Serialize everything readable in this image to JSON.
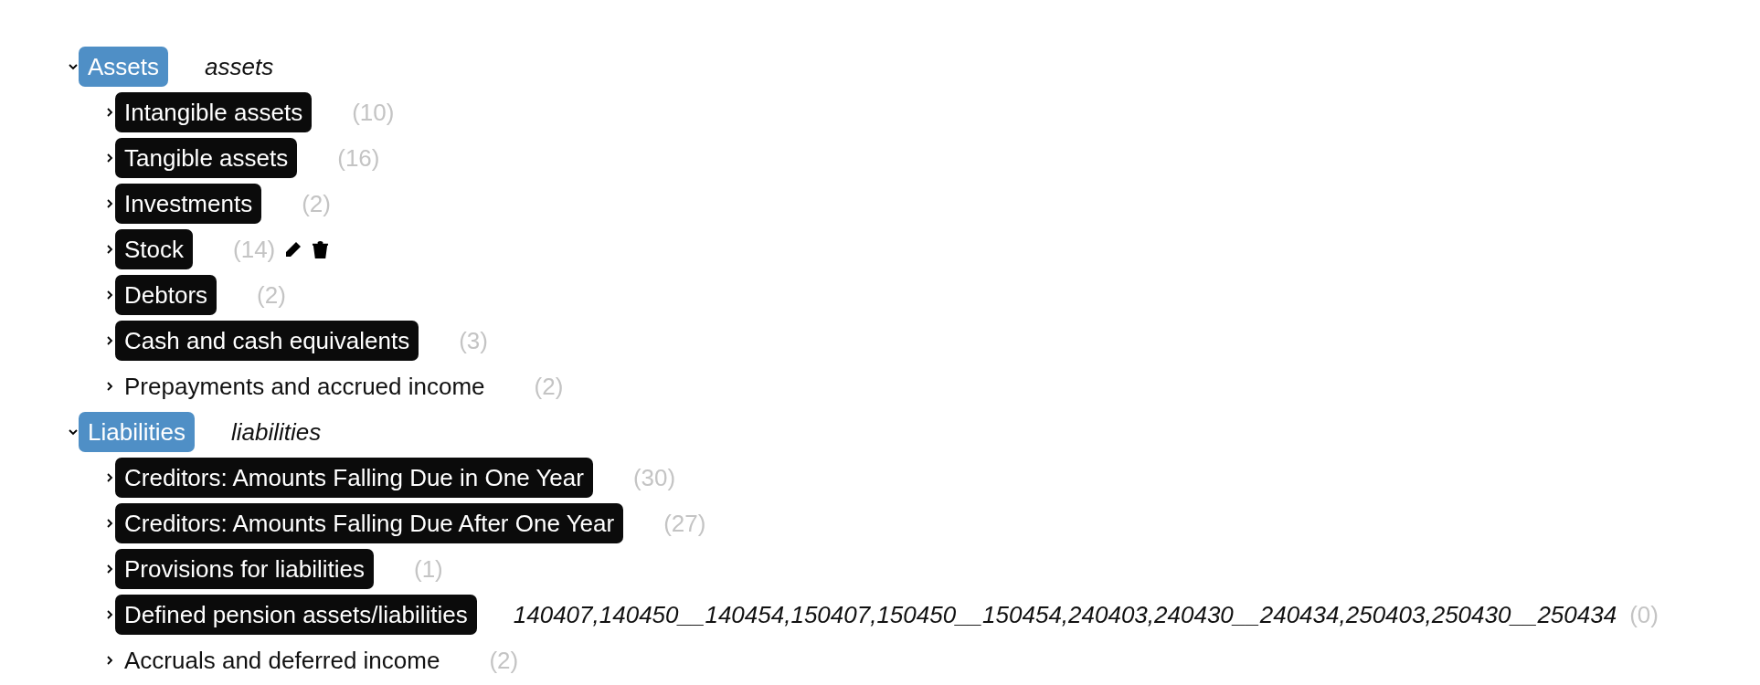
{
  "tree": [
    {
      "label": "Assets",
      "note": "assets",
      "expanded": true,
      "children": [
        {
          "label": "Intangible assets",
          "highlighted": true,
          "count": "(10)",
          "expanded": false,
          "actions": false
        },
        {
          "label": "Tangible assets",
          "highlighted": true,
          "count": "(16)",
          "expanded": false,
          "actions": false
        },
        {
          "label": "Investments",
          "highlighted": true,
          "count": "(2)",
          "expanded": false,
          "actions": false
        },
        {
          "label": "Stock",
          "highlighted": true,
          "count": "(14)",
          "expanded": false,
          "actions": true
        },
        {
          "label": "Debtors",
          "highlighted": true,
          "count": "(2)",
          "expanded": false,
          "actions": false
        },
        {
          "label": "Cash and cash equivalents",
          "highlighted": true,
          "count": "(3)",
          "expanded": false,
          "actions": false
        },
        {
          "label": "Prepayments and accrued income",
          "highlighted": false,
          "count": "(2)",
          "expanded": false,
          "actions": false
        }
      ]
    },
    {
      "label": "Liabilities",
      "note": "liabilities",
      "expanded": true,
      "children": [
        {
          "label": "Creditors: Amounts Falling Due in One Year",
          "highlighted": true,
          "count": "(30)",
          "expanded": false,
          "actions": false
        },
        {
          "label": "Creditors: Amounts Falling Due After One Year",
          "highlighted": true,
          "count": "(27)",
          "expanded": false,
          "actions": false
        },
        {
          "label": "Provisions for liabilities",
          "highlighted": true,
          "count": "(1)",
          "expanded": false,
          "actions": false
        },
        {
          "label": "Defined pension assets/liabilities",
          "highlighted": true,
          "note": "140407,140450__140454,150407,150450__150454,240403,240430__240434,250403,250430__250434",
          "count": "(0)",
          "expanded": false,
          "actions": false
        },
        {
          "label": "Accruals and deferred income",
          "highlighted": false,
          "count": "(2)",
          "expanded": false,
          "actions": false
        }
      ]
    }
  ]
}
